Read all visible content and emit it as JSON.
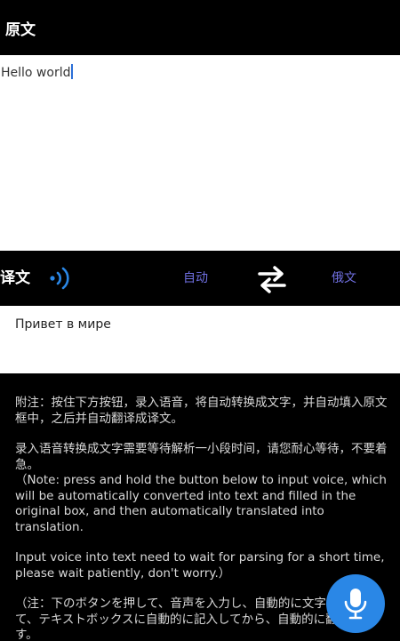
{
  "source": {
    "header_title": "原文",
    "text": "Hello world"
  },
  "toolbar": {
    "translation_label": "译文",
    "source_language": "自动",
    "target_language": "俄文"
  },
  "result": {
    "text": "Привет в мире"
  },
  "notes": {
    "zh_line1": "附注：按住下方按钮，录入语音，将自动转换成文字，并自动填入原文框中，之后并自动翻译成译文。",
    "zh_line2": "录入语音转换成文字需要等待解析一小段时间，请您耐心等待，不要着急。",
    "en_line1": "（Note: press and hold the button below to input voice, which will be automatically converted into text and filled in the original box, and then automatically translated into translation.",
    "en_line2": "Input voice into text need to wait for parsing for a short time, please wait patiently, don't worry.）",
    "ja_line1": "（注：下のボタンを押して、音声を入力し、自動的に文字に変換して、テキストボックスに自動的に記入してから、自動的に翻訳します。"
  },
  "icons": {
    "voice": "voice-wave-icon",
    "swap": "swap-arrows-icon",
    "mic": "microphone-icon"
  },
  "colors": {
    "accent_blue": "#2a87e6",
    "language_text": "#6f6fe0",
    "background": "#000000"
  }
}
